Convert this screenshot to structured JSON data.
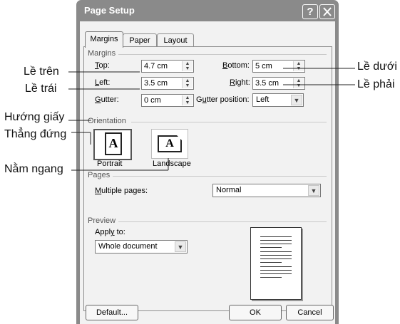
{
  "dialog": {
    "title": "Page Setup",
    "help_button": "?",
    "close_button": "X"
  },
  "tabs": [
    {
      "label": "Margins",
      "active": true
    },
    {
      "label": "Paper",
      "active": false
    },
    {
      "label": "Layout",
      "active": false
    }
  ],
  "margins": {
    "group_label": "Margins",
    "top": {
      "label": "Top:",
      "value": "4.7 cm"
    },
    "bottom": {
      "label": "Bottom:",
      "value": "5 cm"
    },
    "left": {
      "label": "Left:",
      "value": "3.5 cm"
    },
    "right": {
      "label": "Right:",
      "value": "3.5 cm"
    },
    "gutter": {
      "label": "Gutter:",
      "value": "0 cm"
    },
    "gutter_position": {
      "label": "Gutter position:",
      "value": "Left"
    }
  },
  "orientation": {
    "group_label": "Orientation",
    "portrait": {
      "label": "Portrait",
      "glyph": "A",
      "selected": true
    },
    "landscape": {
      "label": "Landscape",
      "glyph": "A",
      "selected": false
    }
  },
  "pages": {
    "group_label": "Pages",
    "multiple_pages_label": "Multiple pages:",
    "multiple_pages_value": "Normal"
  },
  "preview": {
    "group_label": "Preview",
    "apply_to_label": "Apply to:",
    "apply_to_value": "Whole document"
  },
  "buttons": {
    "default": "Default...",
    "ok": "OK",
    "cancel": "Cancel"
  },
  "annotations": {
    "le_tren": "Lề trên",
    "le_trai": "Lề trái",
    "huong_giay": "Hướng giấy",
    "thang_dung": "Thẳng đứng",
    "nam_ngang": "Nằm ngang",
    "le_duoi": "Lề dưới",
    "le_phai": "Lề phải"
  },
  "colors": {
    "titlebar": "#8a8a8a",
    "dialog_bg": "#f2f2f2"
  }
}
